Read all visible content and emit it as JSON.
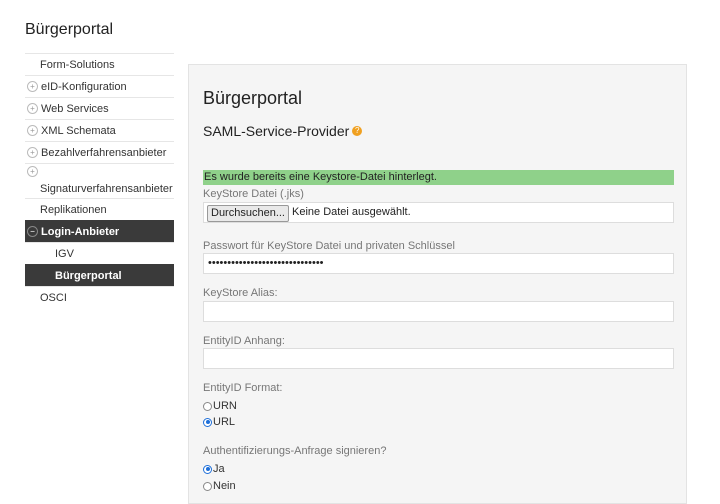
{
  "app": {
    "title": "Bürgerportal"
  },
  "sidebar": {
    "items": [
      {
        "label": "Form-Solutions"
      },
      {
        "label": "eID-Konfiguration"
      },
      {
        "label": "Web Services"
      },
      {
        "label": "XML Schemata"
      },
      {
        "label": "Bezahlverfahrensanbieter"
      },
      {
        "label": "Signaturverfahrensanbieter"
      },
      {
        "label": "Replikationen"
      },
      {
        "label": "Login-Anbieter"
      },
      {
        "label": "IGV"
      },
      {
        "label": "Bürgerportal"
      },
      {
        "label": "OSCI"
      }
    ]
  },
  "main": {
    "title": "Bürgerportal",
    "subtitle": "SAML-Service-Provider",
    "alert": "Es wurde bereits eine Keystore-Datei hinterlegt.",
    "keystore": {
      "label": "KeyStore Datei (.jks)",
      "button": "Durchsuchen...",
      "status": "Keine Datei ausgewählt."
    },
    "password": {
      "label": "Passwort für KeyStore Datei und privaten Schlüssel",
      "value": "••••••••••••••••••••••••••••••"
    },
    "alias": {
      "label": "KeyStore Alias:",
      "value": ""
    },
    "entity_suffix": {
      "label": "EntityID Anhang:",
      "value": ""
    },
    "entity_format": {
      "label": "EntityID Format:",
      "options": [
        "URN",
        "URL"
      ],
      "selected": "URL"
    },
    "sign_request": {
      "label": "Authentifizierungs-Anfrage signieren?",
      "options": [
        "Ja",
        "Nein"
      ],
      "selected": "Ja"
    }
  },
  "icons": {
    "expand": "plus-circle-icon",
    "collapse": "minus-circle-icon",
    "help": "help-icon"
  },
  "colors": {
    "alert_bg": "#8fd18a",
    "active_nav_bg": "#3a3a3a",
    "radio_accent": "#1e6fd9",
    "help_icon": "#f0a020"
  }
}
